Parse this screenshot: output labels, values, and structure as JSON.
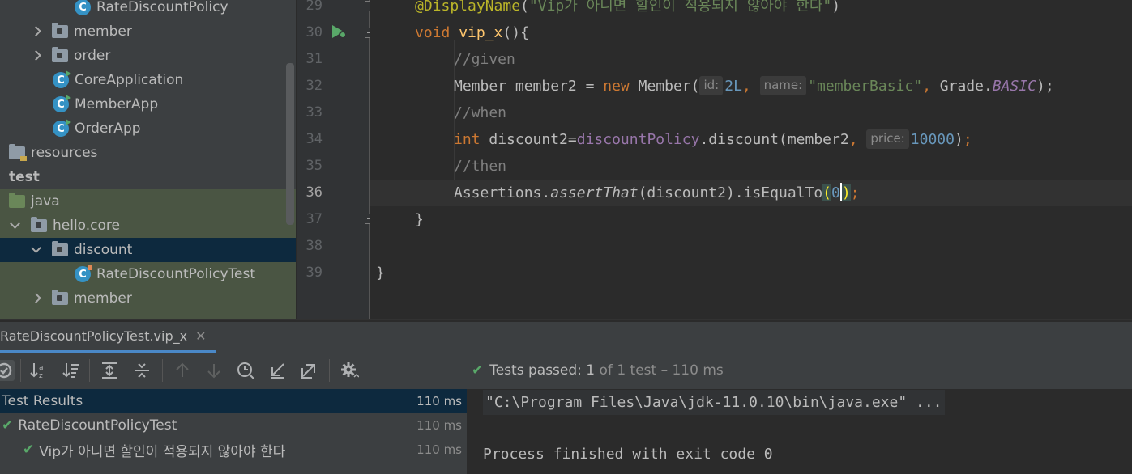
{
  "tree": {
    "items": [
      {
        "label": "RateDiscountPolicy",
        "kind": "class"
      },
      {
        "label": "member",
        "kind": "folder"
      },
      {
        "label": "order",
        "kind": "folder"
      },
      {
        "label": "CoreApplication",
        "kind": "class-run"
      },
      {
        "label": "MemberApp",
        "kind": "class-run"
      },
      {
        "label": "OrderApp",
        "kind": "class-run"
      },
      {
        "label": "resources",
        "kind": "resources-folder"
      },
      {
        "label": "test",
        "kind": "root"
      },
      {
        "label": "java",
        "kind": "test-folder"
      },
      {
        "label": "hello.core",
        "kind": "package"
      },
      {
        "label": "discount",
        "kind": "package-selected"
      },
      {
        "label": "RateDiscountPolicyTest",
        "kind": "test-class"
      },
      {
        "label": "member",
        "kind": "package"
      }
    ]
  },
  "editor": {
    "line_numbers": [
      "29",
      "30",
      "31",
      "32",
      "33",
      "34",
      "35",
      "36",
      "37",
      "38",
      "39"
    ],
    "annotation": "@DisplayName",
    "display_name_string": "\"Vip가 아니면 할인이 적용되지 않아야 한다\"",
    "kw_void": "void",
    "method_name": "vip_x",
    "comment_given": "//given",
    "comment_when": "//when",
    "comment_then": "//then",
    "type_member": "Member",
    "var_member2": "member2",
    "kw_new": "new",
    "hint_id": "id:",
    "val_2l": "2L",
    "hint_name": "name:",
    "str_member_basic": "\"memberBasic\"",
    "grade_class": "Grade.",
    "grade_basic": "BASIC",
    "kw_int": "int",
    "var_discount2": "discount2",
    "field_discount_policy": "discountPolicy",
    "call_discount": ".discount(member2",
    "hint_price": "price:",
    "val_10000": "10000",
    "assertions": "Assertions.",
    "assert_that": "assertThat",
    "assert_args": "(discount2).isEqualTo",
    "val_zero": "0"
  },
  "run_tab": {
    "label": "RateDiscountPolicyTest.vip_x"
  },
  "toolbar": {
    "tests_passed_label": "Tests passed:",
    "tests_passed_count": "1",
    "tests_passed_rest": "of 1 test – 110 ms"
  },
  "results": {
    "rows": [
      {
        "label": "Test Results",
        "time": "110 ms"
      },
      {
        "label": "RateDiscountPolicyTest",
        "time": "110 ms"
      },
      {
        "label": "Vip가 아니면 할인이 적용되지 않아야 한다",
        "time": "110 ms"
      }
    ]
  },
  "console": {
    "command": "\"C:\\Program Files\\Java\\jdk-11.0.10\\bin\\java.exe\" ...",
    "exit": "Process finished with exit code 0"
  },
  "colors": {
    "keyword": "#cc7832",
    "string": "#6a8759",
    "method": "#ffc66d",
    "comment": "#808080",
    "number": "#6897bb",
    "field": "#9876aa",
    "pass": "#59a869",
    "selection": "#0d293e"
  }
}
